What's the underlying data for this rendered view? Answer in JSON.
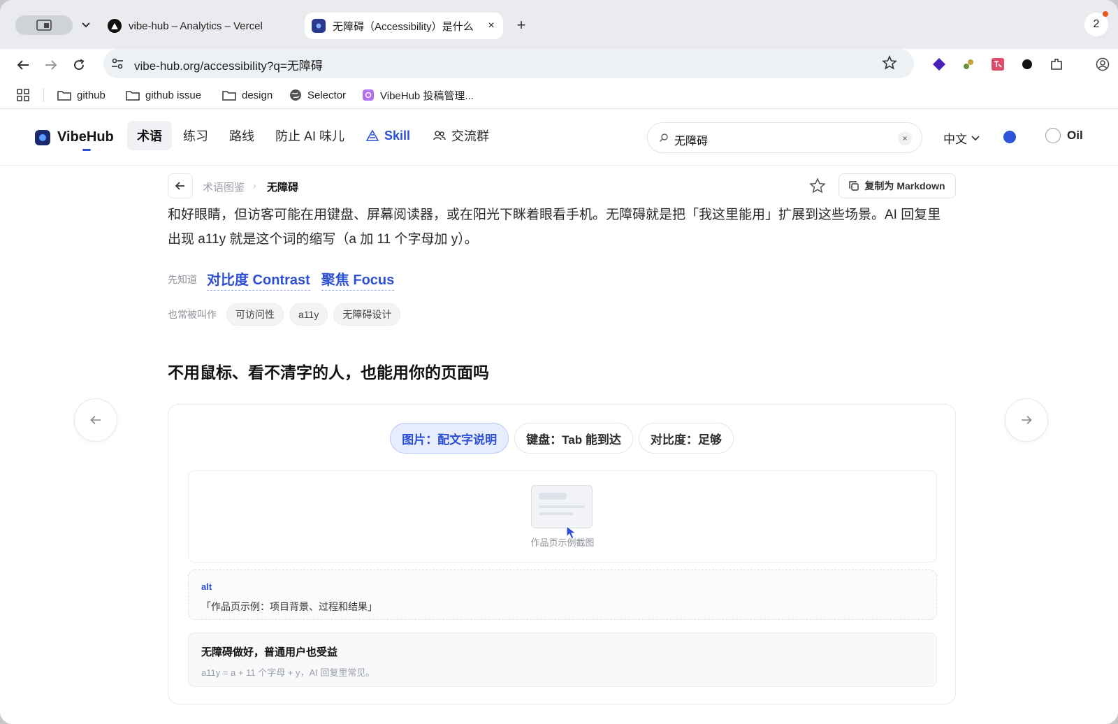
{
  "browser": {
    "tabs": [
      {
        "title": "vibe-hub – Analytics – Vercel",
        "favicon": "vercel-icon"
      },
      {
        "title": "无障碍（Accessibility）是什么",
        "favicon": "vibehub-icon",
        "active": true,
        "close": "×"
      }
    ],
    "new_tab": "+",
    "profile_count": "2",
    "url": "vibe-hub.org/accessibility?q=无障碍",
    "bookmarks": [
      {
        "label": "github",
        "icon": "folder-icon"
      },
      {
        "label": "github issue",
        "icon": "folder-icon"
      },
      {
        "label": "design",
        "icon": "folder-icon"
      },
      {
        "label": "Selector",
        "icon": "globe-icon"
      },
      {
        "label": "VibeHub 投稿管理...",
        "icon": "vibehub-icon"
      }
    ]
  },
  "app": {
    "logo": "VibeHub",
    "nav": [
      {
        "label": "术语",
        "active": true
      },
      {
        "label": "练习"
      },
      {
        "label": "路线"
      },
      {
        "label": "防止 AI 味儿"
      },
      {
        "label": "Skill",
        "icon": "skill-icon"
      },
      {
        "label": "交流群",
        "icon": "group-icon"
      }
    ],
    "search": {
      "value": "无障碍",
      "clear": "×"
    },
    "language": "中文",
    "user": "Oil"
  },
  "page": {
    "breadcrumb": {
      "parent": "术语图鉴",
      "sep": "›",
      "current": "无障碍"
    },
    "copy_markdown": "复制为 Markdown",
    "body_text": "和好眼睛，但访客可能在用键盘、屏幕阅读器，或在阳光下眯着眼看手机。无障碍就是把「我这里能用」扩展到这些场景。AI 回复里出现 a11y 就是这个词的缩写（a 加 11 个字母加 y）。",
    "prereq_label": "先知道",
    "prereqs": [
      "对比度 Contrast",
      "聚焦 Focus"
    ],
    "alias_label": "也常被叫作",
    "aliases": [
      "可访问性",
      "a11y",
      "无障碍设计"
    ],
    "section_heading": "不用鼠标、看不清字的人，也能用你的页面吗",
    "demo": {
      "tabs": [
        "图片：配文字说明",
        "键盘：Tab 能到达",
        "对比度：足够"
      ],
      "active_tab": 0,
      "thumb_caption": "作品页示例截图",
      "alt_label": "alt",
      "alt_text": "「作品页示例：项目背景、过程和结果」",
      "note_title": "无障碍做好，普通用户也受益",
      "note_sub": "a11y = a + 11 个字母 + y，AI 回复里常见。"
    }
  },
  "colors": {
    "accent": "#2c4fd6",
    "active_tab_bg": "#e7edff"
  }
}
